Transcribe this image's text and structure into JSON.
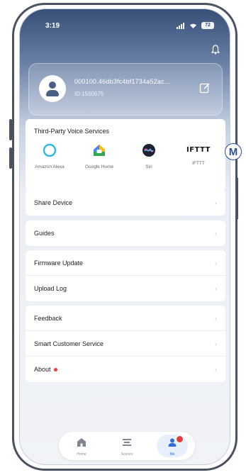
{
  "status_bar": {
    "time": "3:19",
    "battery": "72"
  },
  "profile": {
    "name": "000100.46db3fc4bf1734a52ac...",
    "id": "ID:1560675"
  },
  "voice_services": {
    "title": "Third-Party Voice Services",
    "items": [
      {
        "label": "Amazon Alexa",
        "icon": "amazon-alexa-icon"
      },
      {
        "label": "Google Home",
        "icon": "google-home-icon"
      },
      {
        "label": "Siri",
        "icon": "siri-icon"
      },
      {
        "label": "IFTTT",
        "icon": "ifttt-icon",
        "logo_text": "IFTTT"
      }
    ]
  },
  "menu": {
    "share_device": "Share Device",
    "guides": "Guides",
    "firmware_update": "Firmware Update",
    "upload_log": "Upload Log",
    "feedback": "Feedback",
    "smart_customer_service": "Smart Customer Service",
    "about": "About"
  },
  "tabbar": {
    "home": "Home",
    "scenes": "Scenes",
    "me": "Me"
  },
  "annotation": {
    "marker": "M"
  },
  "colors": {
    "accent": "#2f6cd8",
    "alert": "#e83c3c",
    "header_top": "#3a4f78"
  }
}
